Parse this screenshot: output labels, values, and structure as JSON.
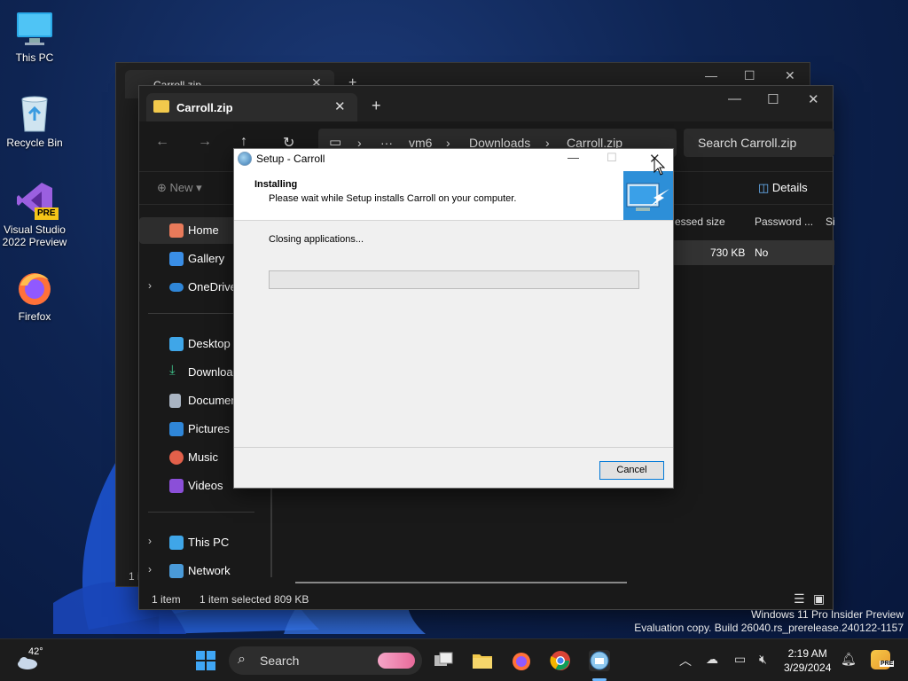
{
  "desktop": {
    "icons": [
      {
        "label": "This PC",
        "icon": "monitor-icon"
      },
      {
        "label": "Recycle Bin",
        "icon": "recycle-bin-icon"
      },
      {
        "label": "Visual Studio 2022 Preview",
        "badge": "PRE",
        "icon": "visual-studio-icon"
      },
      {
        "label": "Firefox",
        "icon": "firefox-icon"
      }
    ],
    "watermark_line1": "Windows 11 Pro Insider Preview",
    "watermark_line2": "Evaluation copy. Build 26040.rs_prerelease.240122-1157"
  },
  "back_window": {
    "tab_title": "Carroll.zip",
    "partial_status": "1 i"
  },
  "explorer": {
    "tab_title": "Carroll.zip",
    "breadcrumb": [
      "vm6",
      "Downloads",
      "Carroll.zip"
    ],
    "breadcrumb_more": "···",
    "search_placeholder": "Search Carroll.zip",
    "new_label": "New",
    "details_label": "Details",
    "columns": [
      "essed size",
      "Password ...",
      "Si"
    ],
    "row": {
      "compressed_size": "730 KB",
      "password": "No"
    },
    "sidebar": [
      {
        "label": "Home",
        "icon": "home-icon"
      },
      {
        "label": "Gallery",
        "icon": "gallery-icon"
      },
      {
        "label": "OneDrive",
        "icon": "onedrive-icon"
      },
      {
        "label": "Desktop",
        "icon": "desktop-icon"
      },
      {
        "label": "Downloa",
        "icon": "download-icon"
      },
      {
        "label": "Documen",
        "icon": "documents-icon"
      },
      {
        "label": "Pictures",
        "icon": "pictures-icon"
      },
      {
        "label": "Music",
        "icon": "music-icon"
      },
      {
        "label": "Videos",
        "icon": "videos-icon"
      },
      {
        "label": "This PC",
        "icon": "this-pc-icon"
      },
      {
        "label": "Network",
        "icon": "network-icon"
      }
    ],
    "status_items": "1 item",
    "status_selected": "1 item selected  809 KB"
  },
  "setup": {
    "title": "Setup - Carroll",
    "heading": "Installing",
    "subheading": "Please wait while Setup installs Carroll on your computer.",
    "status": "Closing applications...",
    "progress_percent": 0,
    "cancel_label": "Cancel",
    "progress_color": "#06b025"
  },
  "taskbar": {
    "weather_temp": "42°",
    "search_label": "Search",
    "time": "2:19 AM",
    "date": "3/29/2024",
    "copilot_badge": "PRE"
  }
}
